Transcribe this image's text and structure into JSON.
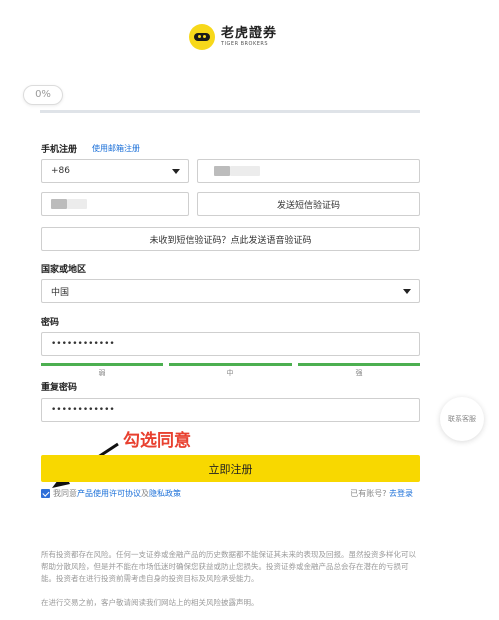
{
  "brand": {
    "name_cn": "老虎證券",
    "name_en": "TIGER BROKERS"
  },
  "progress": {
    "text": "0%",
    "value": 0
  },
  "phone_section": {
    "label": "手机注册",
    "switch_link": "使用邮箱注册",
    "country_code": "+86",
    "sms_button": "发送短信验证码",
    "voice_code_button": "未收到短信验证码？点此发送语音验证码"
  },
  "region": {
    "label": "国家或地区",
    "value": "中国"
  },
  "password": {
    "label": "密码",
    "value": "••••••••••••",
    "strength_labels": [
      "弱",
      "中",
      "强"
    ],
    "strength_color": "#4caf50"
  },
  "confirm_password": {
    "label": "重复密码",
    "value": "••••••••••••"
  },
  "annotation": "勾选同意",
  "submit_button": "立即注册",
  "agreement": {
    "prefix": "我同意",
    "terms": "产品使用许可协议",
    "and": "及",
    "privacy": "隐私政策",
    "checked": true
  },
  "login": {
    "prompt": "已有账号?",
    "link": "去登录"
  },
  "contact_button": "联系客服",
  "disclaimer": "所有投资都存在风险。任何一支证券或金融产品的历史数据都不能保证其未来的表现及回报。虽然投资多样化可以帮助分散风险，但是并不能在市场低迷时确保您获益或防止您损失。投资证券或金融产品总会存在潜在的亏损可能。投资者在进行投资前需考虑自身的投资目标及风险承受能力。",
  "disclaimer2": "在进行交易之前，客户敬请阅读我们网站上的相关风险披露声明。",
  "colors": {
    "accent": "#f8d800",
    "link": "#1a6fd8",
    "annotation": "#e8402f"
  }
}
